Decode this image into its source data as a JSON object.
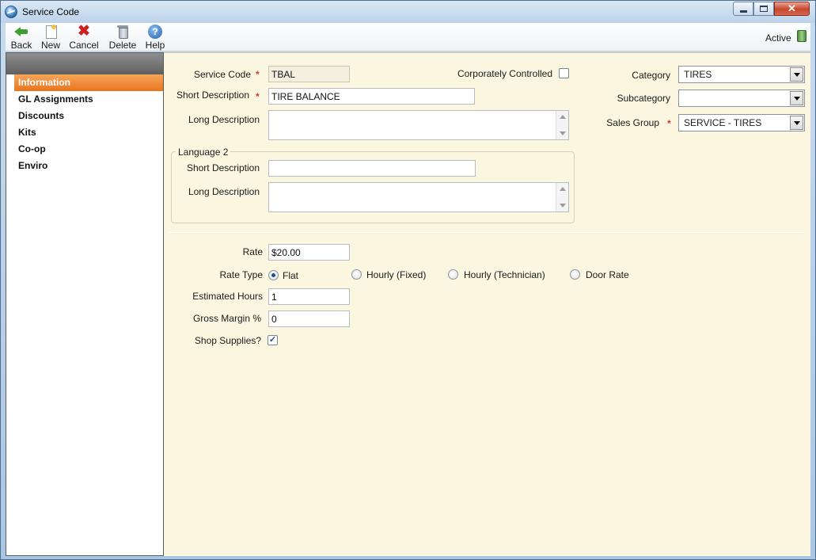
{
  "window": {
    "title": "Service Code"
  },
  "toolbar": {
    "back": "Back",
    "new": "New",
    "cancel": "Cancel",
    "delete": "Delete",
    "help": "Help",
    "help_glyph": "?",
    "status": "Active"
  },
  "sidebar": {
    "items": [
      {
        "label": "Information",
        "active": true
      },
      {
        "label": "GL Assignments"
      },
      {
        "label": "Discounts"
      },
      {
        "label": "Kits"
      },
      {
        "label": "Co-op"
      },
      {
        "label": "Enviro"
      }
    ]
  },
  "form": {
    "service_code_label": "Service Code",
    "service_code_value": "TBAL",
    "short_description_label": "Short Description",
    "short_description_value": "TIRE BALANCE",
    "long_description_label": "Long Description",
    "long_description_value": "",
    "corporately_controlled_label": "Corporately Controlled",
    "corporately_controlled_checked": false,
    "required_marker": "*",
    "language2": {
      "title": "Language 2",
      "short_description_label": "Short Description",
      "short_description_value": "",
      "long_description_label": "Long Description",
      "long_description_value": ""
    },
    "category_label": "Category",
    "category_value": "TIRES",
    "subcategory_label": "Subcategory",
    "subcategory_value": "",
    "sales_group_label": "Sales Group",
    "sales_group_value": "SERVICE - TIRES",
    "rate_label": "Rate",
    "rate_value": "$20.00",
    "rate_type_label": "Rate Type",
    "rate_type_options": [
      "Flat",
      "Hourly (Fixed)",
      "Hourly (Technician)",
      "Door Rate"
    ],
    "rate_type_selected": "Flat",
    "estimated_hours_label": "Estimated Hours",
    "estimated_hours_value": "1",
    "gross_margin_label": "Gross Margin %",
    "gross_margin_value": "0",
    "shop_supplies_label": "Shop Supplies?",
    "shop_supplies_checked": true,
    "check_glyph": "✓"
  },
  "colors": {
    "content_bg": "#faf6e0",
    "active_nav": "#e8751f",
    "required": "#d43a2a"
  }
}
